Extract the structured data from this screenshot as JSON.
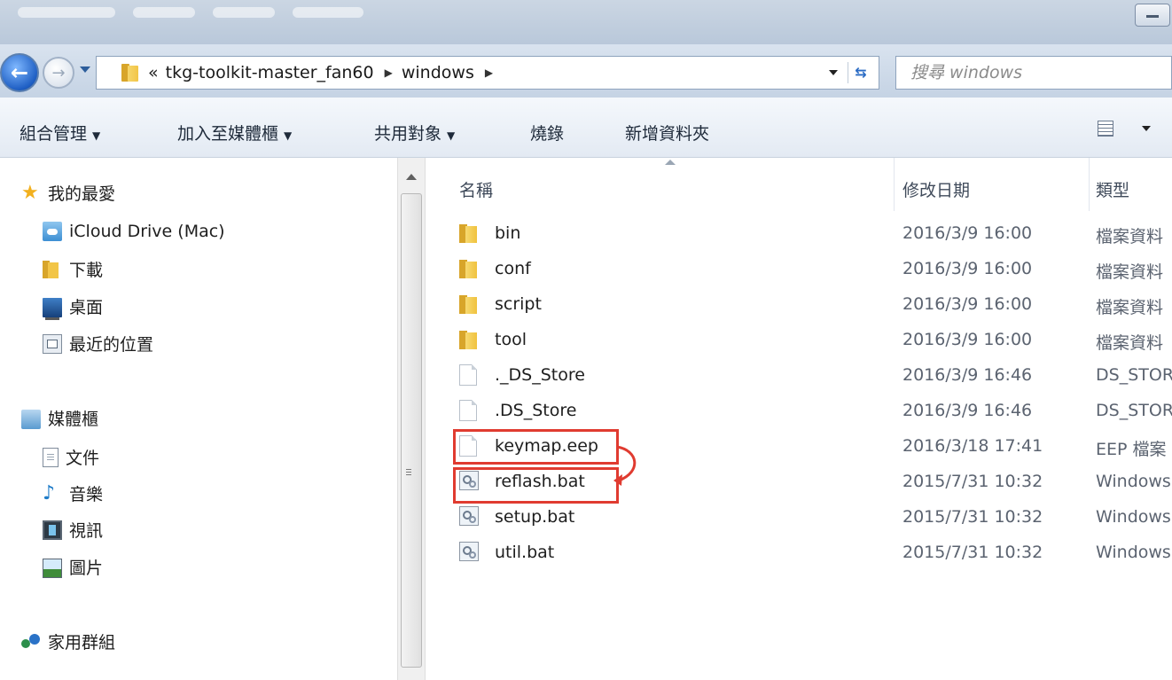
{
  "address": {
    "overflow": "«",
    "crumbs": [
      "tkg-toolkit-master_fan60",
      "windows"
    ]
  },
  "search": {
    "placeholder": "搜尋 windows"
  },
  "toolbar": {
    "organize": "組合管理",
    "add_to_library": "加入至媒體櫃",
    "share_with": "共用對象",
    "burn": "燒錄",
    "new_folder": "新增資料夾"
  },
  "nav": {
    "favorites": "我的最愛",
    "icloud": "iCloud Drive (Mac)",
    "downloads": "下載",
    "desktop": "桌面",
    "recent": "最近的位置",
    "libraries": "媒體櫃",
    "documents": "文件",
    "music": "音樂",
    "videos": "視訊",
    "pictures": "圖片",
    "homegroup": "家用群組"
  },
  "columns": {
    "name": "名稱",
    "date": "修改日期",
    "type": "類型"
  },
  "files": [
    {
      "name": "bin",
      "date": "2016/3/9 16:00",
      "type": "檔案資料",
      "icon": "folder-icon"
    },
    {
      "name": "conf",
      "date": "2016/3/9 16:00",
      "type": "檔案資料",
      "icon": "folder-icon"
    },
    {
      "name": "script",
      "date": "2016/3/9 16:00",
      "type": "檔案資料",
      "icon": "folder-icon"
    },
    {
      "name": "tool",
      "date": "2016/3/9 16:00",
      "type": "檔案資料",
      "icon": "folder-icon"
    },
    {
      "name": "._DS_Store",
      "date": "2016/3/9 16:46",
      "type": "DS_STORE",
      "icon": "file-icon"
    },
    {
      "name": ".DS_Store",
      "date": "2016/3/9 16:46",
      "type": "DS_STORE",
      "icon": "file-icon"
    },
    {
      "name": "keymap.eep",
      "date": "2016/3/18 17:41",
      "type": "EEP 檔案",
      "icon": "file-icon"
    },
    {
      "name": "reflash.bat",
      "date": "2015/7/31 10:32",
      "type": "Windows",
      "icon": "batch-file-icon"
    },
    {
      "name": "setup.bat",
      "date": "2015/7/31 10:32",
      "type": "Windows",
      "icon": "batch-file-icon"
    },
    {
      "name": "util.bat",
      "date": "2015/7/31 10:32",
      "type": "Windows",
      "icon": "batch-file-icon"
    }
  ],
  "colors": {
    "highlight": "#e03b30",
    "folder": "#f2c547",
    "toolbar_bg": "#e3eaf3"
  }
}
